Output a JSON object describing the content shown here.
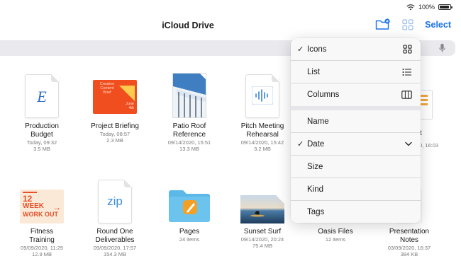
{
  "status_bar": {
    "battery_text": "100%"
  },
  "nav": {
    "title": "iCloud Drive",
    "select_label": "Select"
  },
  "files_row1": [
    {
      "name_line1": "Production",
      "name_line2": "Budget",
      "meta1": "Today, 09:32",
      "meta2": "3.5 MB",
      "thumb": "keynote-e"
    },
    {
      "name_line1": "Project Briefing",
      "name_line2": "",
      "meta1": "Today, 08:57",
      "meta2": "2.3 MB",
      "thumb": "orange-brief"
    },
    {
      "name_line1": "Patio Roof",
      "name_line2": "Reference",
      "meta1": "09/14/2020, 15:51",
      "meta2": "13.3 MB",
      "thumb": "architecture"
    },
    {
      "name_line1": "Pitch Meeting",
      "name_line2": "Rehearsal",
      "meta1": "09/14/2020, 15:42",
      "meta2": "3.2 MB",
      "thumb": "audio"
    },
    {
      "name_line1": "t",
      "name_line2": "",
      "meta1": "0, 16:03",
      "meta2": "",
      "thumb": "partial-doc"
    }
  ],
  "files_row2": [
    {
      "name_line1": "Fitness",
      "name_line2": "Training",
      "meta1": "09/09/2020, 11:29",
      "meta2": "12.9 MB",
      "thumb": "workout"
    },
    {
      "name_line1": "Round One",
      "name_line2": "Deliverables",
      "meta1": "09/09/2020, 17:57",
      "meta2": "154.3 MB",
      "thumb": "zip"
    },
    {
      "name_line1": "Pages",
      "name_line2": "",
      "meta1": "24 items",
      "meta2": "",
      "thumb": "folder-pages"
    },
    {
      "name_line1": "Sunset Surf",
      "name_line2": "",
      "meta1": "09/14/2020, 20:24",
      "meta2": "75.4 MB",
      "thumb": "surf"
    },
    {
      "name_line1": "Oasis Files",
      "name_line2": "",
      "meta1": "12 items",
      "meta2": "",
      "thumb": "folder-blank"
    },
    {
      "name_line1": "Presentation",
      "name_line2": "Notes",
      "meta1": "03/09/2020, 16:37",
      "meta2": "384 KB",
      "thumb": "doc-faint"
    }
  ],
  "thumb_text": {
    "brief_title": "Creative Content Brief",
    "brief_sub": "June 4th",
    "workout_line1": "12",
    "workout_line2": "WEEK",
    "workout_line3": "WORK OUT",
    "zip_label": "zip",
    "keynote_letter": "E"
  },
  "menu": {
    "view_options": [
      {
        "label": "Icons",
        "checked": true,
        "icon": "grid-icon"
      },
      {
        "label": "List",
        "checked": false,
        "icon": "list-icon"
      },
      {
        "label": "Columns",
        "checked": false,
        "icon": "columns-icon"
      }
    ],
    "sort_options": [
      {
        "label": "Name",
        "checked": false
      },
      {
        "label": "Date",
        "checked": true,
        "chevron": "chevron-down-icon"
      },
      {
        "label": "Size",
        "checked": false
      },
      {
        "label": "Kind",
        "checked": false
      },
      {
        "label": "Tags",
        "checked": false
      }
    ],
    "checkmark": "✓"
  },
  "colors": {
    "accent": "#1a73e8",
    "menu_bg": "#f8f8f8",
    "folder_blue": "#5cb8e6",
    "brief_orange": "#f04e1f"
  }
}
